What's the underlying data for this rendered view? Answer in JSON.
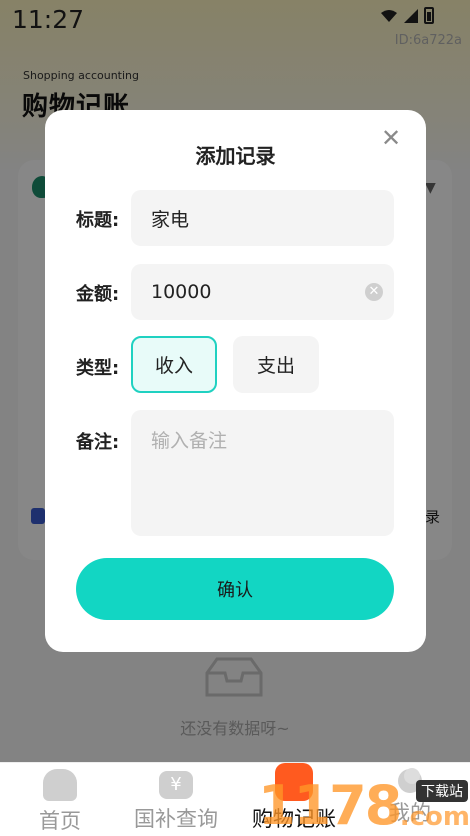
{
  "status_bar": {
    "time": "11:27"
  },
  "app_id": "ID:6a722a",
  "header": {
    "subtitle_en": "Shopping accounting",
    "title": "购物记账"
  },
  "background": {
    "record_link": "录",
    "empty_text": "还没有数据呀~"
  },
  "dialog": {
    "title": "添加记录",
    "close_icon": "close-icon",
    "fields": {
      "title_label": "标题:",
      "title_value": "家电",
      "amount_label": "金额:",
      "amount_value": "10000",
      "type_label": "类型:",
      "type_options": [
        "收入",
        "支出"
      ],
      "type_selected": "收入",
      "note_label": "备注:",
      "note_placeholder": "输入备注"
    },
    "confirm_label": "确认"
  },
  "tabbar": {
    "items": [
      {
        "label": "首页",
        "icon": "home-icon",
        "active": false
      },
      {
        "label": "国补查询",
        "icon": "yuan-icon",
        "active": false
      },
      {
        "label": "购物记账",
        "icon": "ledger-icon",
        "active": true
      },
      {
        "label": "我的",
        "icon": "profile-icon",
        "active": false
      }
    ]
  },
  "watermark": {
    "digits": "1178",
    "tag": "下载站",
    "suffix": ".com"
  },
  "colors": {
    "accent": "#12d6c3",
    "selected_border": "#1fd1c1",
    "tab_active_icon": "#ff5a1f"
  }
}
